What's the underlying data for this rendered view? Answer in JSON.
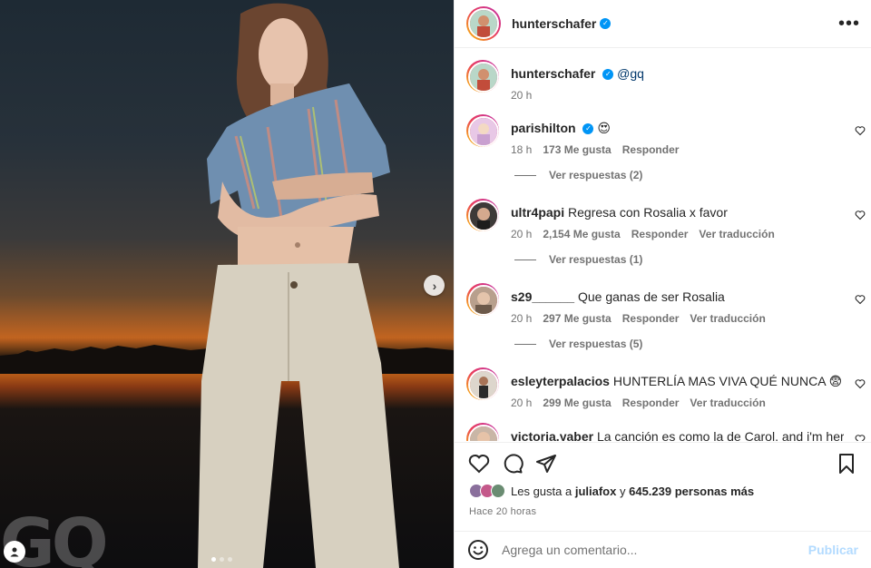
{
  "post": {
    "author": "hunterschafer",
    "caption_mention": "@gq",
    "caption_time": "20 h",
    "photo_watermark": "GQ",
    "carousel_dots": 3,
    "carousel_index": 1
  },
  "comments": [
    {
      "user": "parishilton",
      "verified": true,
      "text": "😍",
      "time": "18 h",
      "likes": "173 Me gusta",
      "reply": "Responder",
      "translate": "",
      "replies": "Ver respuestas (2)"
    },
    {
      "user": "ultr4papi",
      "verified": false,
      "text": "Regresa con Rosalia x favor",
      "time": "20 h",
      "likes": "2,154 Me gusta",
      "reply": "Responder",
      "translate": "Ver traducción",
      "replies": "Ver respuestas (1)"
    },
    {
      "user": "s29______",
      "verified": false,
      "text": "Que ganas de ser Rosalia",
      "time": "20 h",
      "likes": "297 Me gusta",
      "reply": "Responder",
      "translate": "Ver traducción",
      "replies": "Ver respuestas (5)"
    },
    {
      "user": "esleyterpalacios",
      "verified": false,
      "text": "HUNTERLÍA MAS VIVA QUÉ NUNCA 😨 ❤️",
      "time": "20 h",
      "likes": "299 Me gusta",
      "reply": "Responder",
      "translate": "Ver traducción",
      "replies": ""
    },
    {
      "user": "victoria.yaber",
      "verified": false,
      "text": "La canción es como la de Carol, and i'm here for",
      "time": "",
      "likes": "",
      "reply": "",
      "translate": "",
      "replies": ""
    }
  ],
  "likes_line": {
    "prefix": "Les gusta a",
    "user": "juliafox",
    "middle": "y",
    "count": "645.239 personas más"
  },
  "posted": "Hace 20 horas",
  "add_comment": {
    "placeholder": "Agrega un comentario...",
    "publish": "Publicar"
  },
  "colors": {
    "verified": "#0095f6",
    "link": "#00376b",
    "muted": "#737373",
    "publish_disabled": "#b3dbff"
  }
}
